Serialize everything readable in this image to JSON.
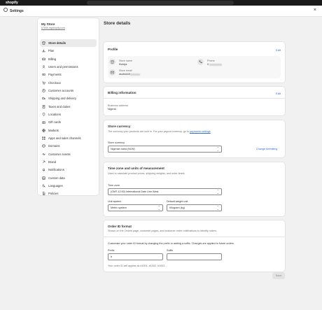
{
  "topbar": {
    "logo": "shopify"
  },
  "header": {
    "title": "Settings",
    "close": "×"
  },
  "store": {
    "name": "My Store",
    "domain": "6700b.myshopify.com"
  },
  "nav": [
    {
      "label": "Store details",
      "icon": "store-icon"
    },
    {
      "label": "Plan",
      "icon": "chart-icon"
    },
    {
      "label": "Billing",
      "icon": "billing-icon"
    },
    {
      "label": "Users and permissions",
      "icon": "user-icon"
    },
    {
      "label": "Payments",
      "icon": "payments-icon"
    },
    {
      "label": "Checkout",
      "icon": "cart-icon"
    },
    {
      "label": "Customer accounts",
      "icon": "person-icon"
    },
    {
      "label": "Shipping and delivery",
      "icon": "truck-icon"
    },
    {
      "label": "Taxes and duties",
      "icon": "tax-icon"
    },
    {
      "label": "Locations",
      "icon": "location-icon"
    },
    {
      "label": "Gift cards",
      "icon": "gift-icon"
    },
    {
      "label": "Markets",
      "icon": "globe-icon"
    },
    {
      "label": "Apps and sales channels",
      "icon": "apps-icon"
    },
    {
      "label": "Domains",
      "icon": "domain-icon"
    },
    {
      "label": "Customer events",
      "icon": "events-icon"
    },
    {
      "label": "Brand",
      "icon": "brand-icon"
    },
    {
      "label": "Notifications",
      "icon": "bell-icon"
    },
    {
      "label": "Custom data",
      "icon": "data-icon"
    },
    {
      "label": "Languages",
      "icon": "language-icon"
    },
    {
      "label": "Policies",
      "icon": "policy-icon"
    }
  ],
  "page_title": "Store details",
  "profile": {
    "title": "Profile",
    "edit": "Edit",
    "store_name_label": "Store name",
    "store_name_value": "Kicklys",
    "phone_label": "Phone",
    "phone_value": "0",
    "email_label": "Store email",
    "email_value": "asutsolutl"
  },
  "billing": {
    "title": "Billing information",
    "edit": "Edit",
    "address_label": "Business address",
    "address_value": "Nigeria"
  },
  "currency": {
    "title": "Store currency",
    "desc": "The currency your products are sold in. For your payout currency, go to",
    "desc_link": "payments settings",
    "field_label": "Store currency",
    "value": "Nigerian naira (NGN)",
    "change": "Change formatting"
  },
  "timezone": {
    "title": "Time zone and units of measurement",
    "desc": "Used to calculate product prices, shipping weights, and order times.",
    "tz_label": "Time zone",
    "tz_value": "(GMT-12:00) International Date Line West",
    "unit_label": "Unit system",
    "unit_value": "Metric system",
    "weight_label": "Default weight unit",
    "weight_value": "Kilogram (kg)"
  },
  "order_id": {
    "title": "Order ID format",
    "desc": "Shown on the Orders page, customer pages, and customer order notifications to identify orders.",
    "desc2": "Customize your order ID format by changing the prefix or adding a suffix. Changes are applied to future orders.",
    "prefix_label": "Prefix",
    "prefix_value": "#",
    "suffix_label": "Suffix",
    "suffix_value": "",
    "preview": "Your order ID will appear as #1001, #1002, #1003 ..."
  },
  "save_label": "Save"
}
